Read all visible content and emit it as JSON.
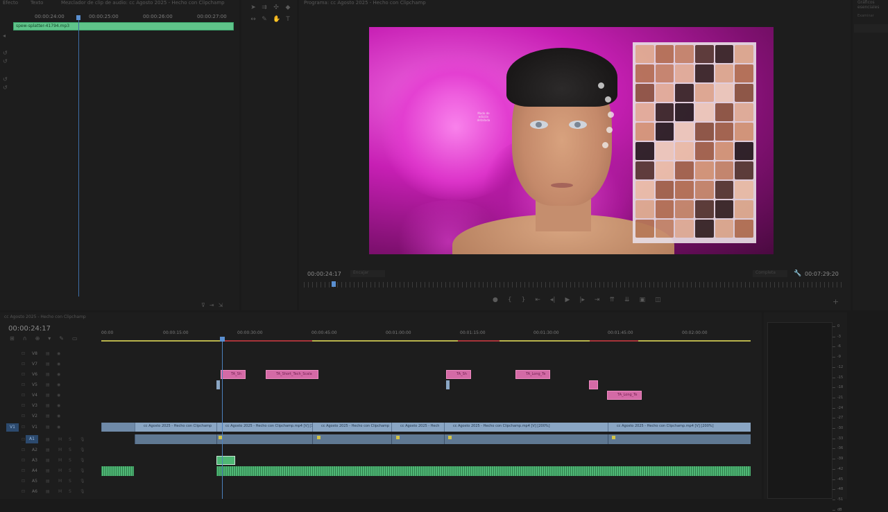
{
  "source": {
    "tabs": [
      "Efecto",
      "Texto",
      "Mezclador de clip de audio: cc Agosto 2025 - Hecho con Clipchamp"
    ],
    "ruler": [
      "00:00:24:00",
      "00:00:25:00",
      "00:00:26:00",
      "00:00:27:00"
    ],
    "clip_name": "spew-splatter-41794.mp3"
  },
  "program": {
    "title": "Programa: cc Agosto 2025 - Hecho con Clipchamp",
    "timecode_current": "00:00:24:17",
    "timecode_duration": "00:07:29:20",
    "fit_label": "Encajar",
    "quality_label": "Completa",
    "video_hint": "Modo de edición detallada"
  },
  "effects_panel": {
    "title": "Gráficos esenciales",
    "subtitle": "Examinar"
  },
  "timeline": {
    "title": "cc Agosto 2025 - Hecho con Clipchamp",
    "timecode": "00:00:24:17",
    "ruler": [
      "00:00",
      "00:00:15:00",
      "00:00:30:00",
      "00:00:45:00",
      "00:01:00:00",
      "00:01:15:00",
      "00:01:30:00",
      "00:01:45:00",
      "00:02:00:00"
    ],
    "tracks": {
      "video": [
        "V8",
        "V7",
        "V6",
        "V5",
        "V4",
        "V3",
        "V2",
        "V1"
      ],
      "audio": [
        "A1",
        "A2",
        "A3",
        "A4",
        "A5",
        "A6"
      ]
    },
    "source_patch_v": "V1",
    "source_patch_a": "A1",
    "pink_clips": [
      {
        "label": "TA_Sh"
      },
      {
        "label": "TA_Short_Tech_Scala"
      },
      {
        "label": "TA_Sh"
      },
      {
        "label": "TA_Long_Te"
      },
      {
        "label": ""
      },
      {
        "label": "TA_Long_Te"
      }
    ],
    "v1_clips": [
      {
        "label": "cc Agosto 2025 - Hecho con Clipchamp"
      },
      {
        "label": "cc Agosto 2025 - Hecho con Clipchamp.mp4 [V] [1"
      },
      {
        "label": "cc Agosto 2025 - Hecho con Clipchamp"
      },
      {
        "label": "cc Agosto 2025 - Hech"
      },
      {
        "label": "cc Agosto 2025 - Hecho con Clipchamp.mp4 [V] [200%]"
      },
      {
        "label": "cc Agosto 2025 - Hecho con Clipchamp.mp4 [V] [200%]"
      }
    ]
  },
  "meter": {
    "labels": [
      "0",
      "-3",
      "-6",
      "-9",
      "-12",
      "-15",
      "-18",
      "-21",
      "-24",
      "-27",
      "-30",
      "-33",
      "-36",
      "-39",
      "-42",
      "-45",
      "-48",
      "-51",
      "dB"
    ]
  },
  "colors": {
    "clip_green": "#4fb775",
    "clip_pink": "#d46aa6",
    "clip_blue": "#8aa6c4",
    "playhead": "#4d82bf",
    "video_magenta": "#c71fb4"
  }
}
